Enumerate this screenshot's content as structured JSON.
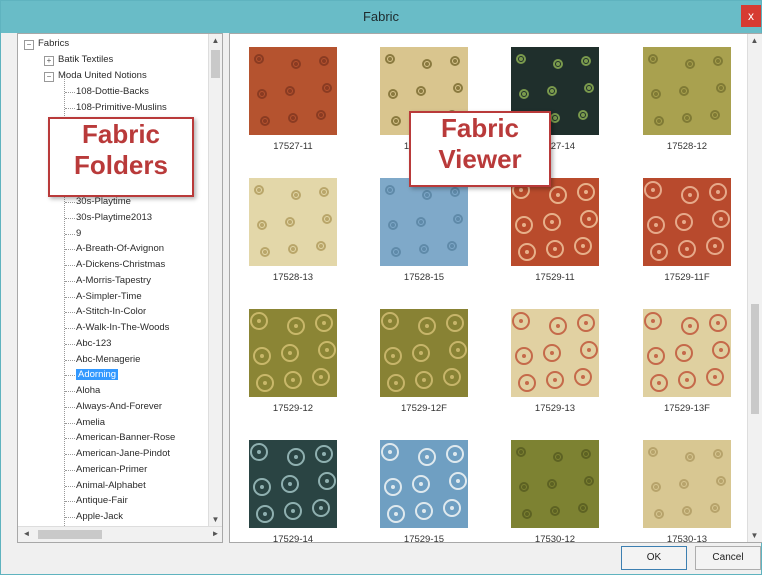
{
  "window": {
    "title": "Fabric",
    "close_label": "x"
  },
  "tree": {
    "root": "Fabrics",
    "level1": [
      "Batik Textiles",
      "Moda United Notions"
    ],
    "items_top": [
      "108-Dottie-Backs",
      "108-Primitive-Muslins"
    ],
    "items_bottom": [
      "30s-Playtime",
      "30s-Playtime2013",
      "9",
      "A-Breath-Of-Avignon",
      "A-Dickens-Christmas",
      "A-Morris-Tapestry",
      "A-Simpler-Time",
      "A-Stitch-In-Color",
      "A-Walk-In-The-Woods",
      "Abc-123",
      "Abc-Menagerie",
      "Adorning",
      "Aloha",
      "Always-And-Forever",
      "Amelia",
      "American-Banner-Rose",
      "American-Jane-Pindot",
      "American-Primer",
      "Animal-Alphabet",
      "Antique-Fair",
      "Apple-Jack"
    ],
    "selected_item": "Adorning"
  },
  "callouts": {
    "folders_line1": "Fabric",
    "folders_line2": "Folders",
    "viewer_line1": "Fabric",
    "viewer_line2": "Viewer"
  },
  "fabrics": [
    {
      "label": "17527-11",
      "bg": "#b5532f",
      "motif": "#8a3b22"
    },
    {
      "label": "17527-12",
      "bg": "#d9c58e",
      "motif": "#8a7a3f"
    },
    {
      "label": "17527-14",
      "bg": "#1f2f2c",
      "motif": "#7a9a4d"
    },
    {
      "label": "17528-12",
      "bg": "#a9a14f",
      "motif": "#7f7a35"
    },
    {
      "label": "17528-13",
      "bg": "#e3d7a9",
      "motif": "#b9a66a"
    },
    {
      "label": "17528-15",
      "bg": "#7fa9c9",
      "motif": "#5f8aa9"
    },
    {
      "label": "17529-11",
      "bg": "#b94b2c",
      "motif": "#e7b08a"
    },
    {
      "label": "17529-11F",
      "bg": "#b84a2d",
      "motif": "#e6a98a"
    },
    {
      "label": "17529-12",
      "bg": "#8b8535",
      "motif": "#c9b86a"
    },
    {
      "label": "17529-12F",
      "bg": "#888234",
      "motif": "#c7b56a"
    },
    {
      "label": "17529-13",
      "bg": "#e1d1a2",
      "motif": "#c56a4a"
    },
    {
      "label": "17529-13F",
      "bg": "#dfd0a0",
      "motif": "#c5694a"
    },
    {
      "label": "17529-14",
      "bg": "#2a4443",
      "motif": "#8fb0b0"
    },
    {
      "label": "17529-15",
      "bg": "#6f9fc2",
      "motif": "#dfe9ee"
    },
    {
      "label": "17530-12",
      "bg": "#7d8232",
      "motif": "#5d6223"
    },
    {
      "label": "17530-13",
      "bg": "#d8c792",
      "motif": "#b7a36b"
    }
  ],
  "buttons": {
    "ok": "OK",
    "cancel": "Cancel"
  }
}
